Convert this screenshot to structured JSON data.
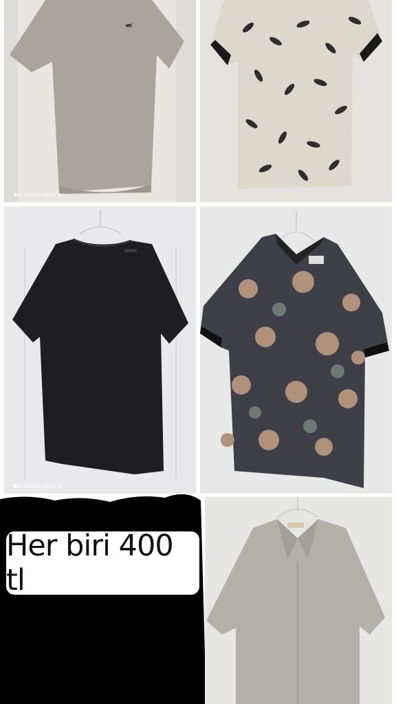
{
  "collage": {
    "price_label": "Her biri 400 tl",
    "watermark_1": "REDMI NOTE 8",
    "watermark_2": "REDMI NOTE 8",
    "items": [
      {
        "name": "beige-tshirt",
        "color": "#a8a49c"
      },
      {
        "name": "leaf-print-polo",
        "color": "#d8d4c8"
      },
      {
        "name": "black-tshirt",
        "color": "#1c1c1e"
      },
      {
        "name": "floral-polo",
        "color": "#3e3e46"
      },
      {
        "name": "beige-camp-shirt",
        "color": "#b3b0a7"
      }
    ]
  }
}
